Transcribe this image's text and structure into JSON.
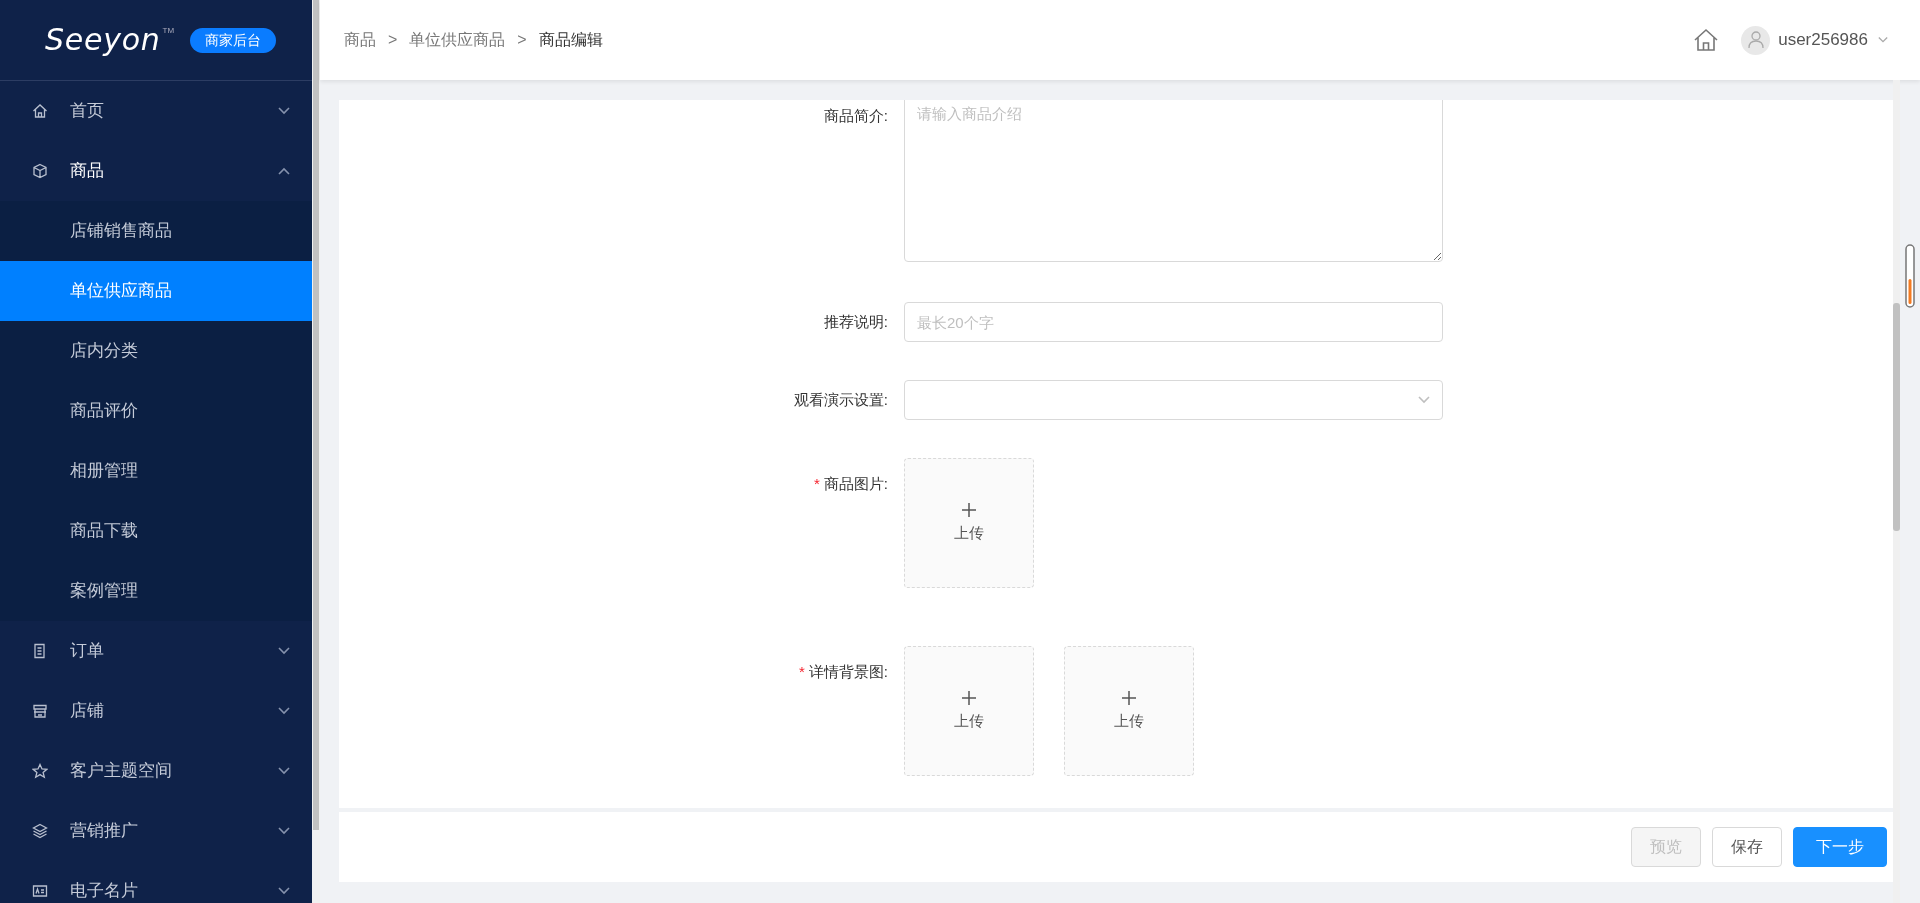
{
  "logo": {
    "text": "Seeyon",
    "trademark": "TM",
    "badge": "商家后台"
  },
  "sidebar": {
    "items": [
      {
        "label": "首页",
        "expanded": false
      },
      {
        "label": "商品",
        "expanded": true,
        "children": [
          {
            "label": "店铺销售商品",
            "selected": false
          },
          {
            "label": "单位供应商品",
            "selected": true
          },
          {
            "label": "店内分类",
            "selected": false
          },
          {
            "label": "商品评价",
            "selected": false
          },
          {
            "label": "相册管理",
            "selected": false
          },
          {
            "label": "商品下载",
            "selected": false
          },
          {
            "label": "案例管理",
            "selected": false
          }
        ]
      },
      {
        "label": "订单",
        "expanded": false
      },
      {
        "label": "店铺",
        "expanded": false
      },
      {
        "label": "客户主题空间",
        "expanded": false
      },
      {
        "label": "营销推广",
        "expanded": false
      },
      {
        "label": "电子名片",
        "expanded": false
      }
    ]
  },
  "breadcrumb": [
    {
      "kind": "link",
      "text": "商品"
    },
    {
      "kind": "separator",
      "text": ">"
    },
    {
      "kind": "link",
      "text": "单位供应商品"
    },
    {
      "kind": "separator",
      "text": ">"
    },
    {
      "kind": "current",
      "text": "商品编辑"
    }
  ],
  "user": {
    "name": "user256986"
  },
  "form": {
    "fields": [
      {
        "kind": "textarea",
        "label": "商品简介:",
        "placeholder": "请输入商品介绍"
      },
      {
        "kind": "input",
        "label": "推荐说明:",
        "placeholder": "最长20个字"
      },
      {
        "kind": "select",
        "label": "观看演示设置:"
      },
      {
        "kind": "upload",
        "label": "商品图片:",
        "required_mark": "*",
        "slots": [
          {
            "label": "上传"
          }
        ]
      },
      {
        "kind": "upload",
        "label": "详情背景图:",
        "required_mark": "*",
        "slots": [
          {
            "label": "上传"
          },
          {
            "label": "上传"
          }
        ]
      }
    ]
  },
  "buttons": [
    {
      "label": "预览",
      "kind": "default",
      "disabled": true
    },
    {
      "label": "保存",
      "kind": "default",
      "disabled": false
    },
    {
      "label": "下一步",
      "kind": "primary",
      "disabled": false
    }
  ]
}
